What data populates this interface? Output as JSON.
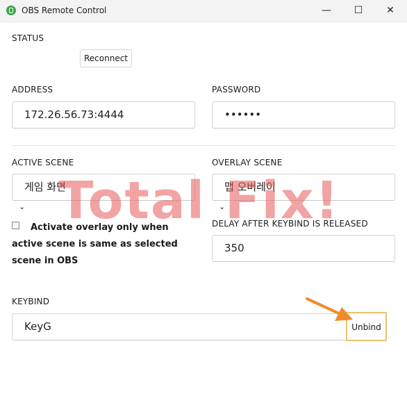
{
  "window": {
    "title": "OBS Remote Control",
    "minimize_glyph": "—",
    "maximize_glyph": "☐",
    "close_glyph": "✕"
  },
  "status": {
    "label": "STATUS",
    "reconnect_label": "Reconnect"
  },
  "address": {
    "label": "ADDRESS",
    "value": "172.26.56.73:4444"
  },
  "password": {
    "label": "PASSWORD",
    "value": "••••••"
  },
  "active_scene": {
    "label": "ACTIVE SCENE",
    "value": "게임 화면"
  },
  "overlay_scene": {
    "label": "OVERLAY SCENE",
    "value": "맵 오버레이"
  },
  "overlay_option": {
    "label": "Activate overlay only when active scene is same as selected scene in OBS",
    "checked": false
  },
  "delay": {
    "label": "DELAY AFTER KEYBIND IS RELEASED",
    "value": "350"
  },
  "keybind": {
    "label": "KEYBIND",
    "value": "KeyG",
    "unbind_label": "Unbind"
  },
  "watermark": "Total Fix!",
  "colors": {
    "accent_arrow": "#f08a2c",
    "highlight_border": "#e8c46a",
    "watermark": "#e85a5a"
  }
}
